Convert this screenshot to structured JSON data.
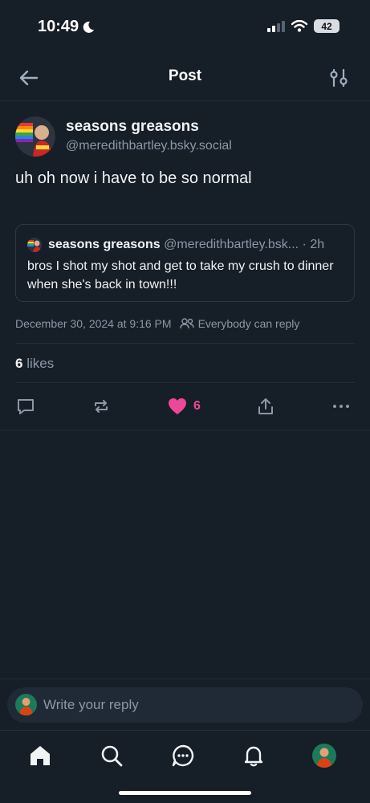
{
  "status_bar": {
    "time": "10:49",
    "battery": "42"
  },
  "header": {
    "title": "Post"
  },
  "post": {
    "author_name": "seasons greasons",
    "author_handle": "@meredithbartley.bsky.social",
    "text": "uh oh now i have to be so normal",
    "quote": {
      "author_name": "seasons greasons",
      "author_handle": "@meredithbartley.bsk...",
      "separator": "·",
      "age": "2h",
      "text": "bros I shot my shot and get to take my crush to dinner when she's back in town!!!"
    },
    "timestamp": "December 30, 2024 at 9:16 PM",
    "reply_setting": "Everybody can reply",
    "likes_count": "6",
    "likes_label": "likes",
    "like_button_count": "6"
  },
  "reply": {
    "placeholder": "Write your reply"
  },
  "colors": {
    "background": "#161e27",
    "like": "#ec4899",
    "muted": "#8b98a7"
  },
  "icons": [
    "back-arrow-icon",
    "settings-sliders-icon",
    "comment-icon",
    "repost-icon",
    "heart-icon",
    "share-icon",
    "more-icon",
    "home-icon",
    "search-icon",
    "chat-icon",
    "bell-icon"
  ]
}
